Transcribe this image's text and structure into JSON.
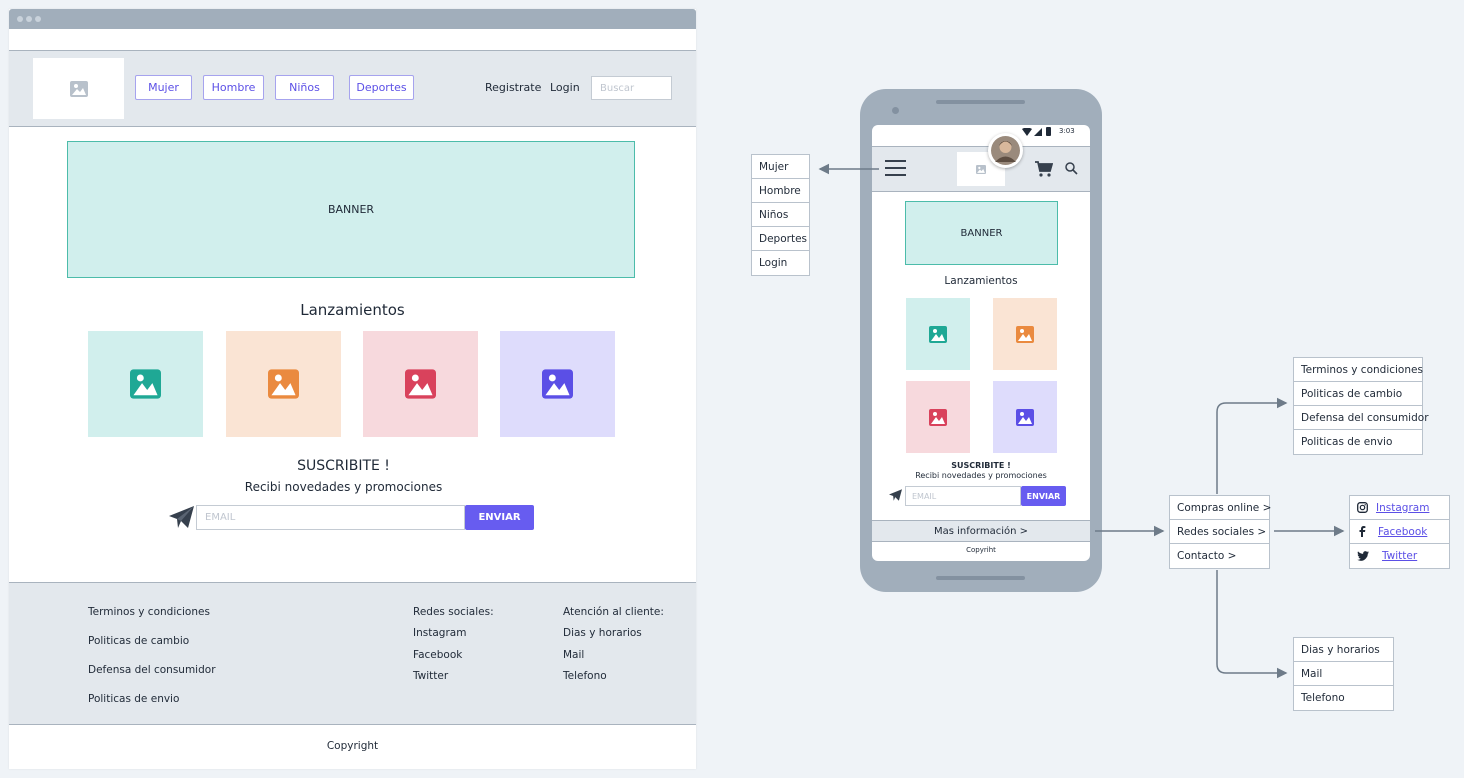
{
  "desktop": {
    "nav": [
      "Mujer",
      "Hombre",
      "Niños",
      "Deportes"
    ],
    "register": "Registrate",
    "login": "Login",
    "search_placeholder": "Buscar",
    "banner": "BANNER",
    "releases_title": "Lanzamientos",
    "subscribe_title": "SUSCRIBITE !",
    "subscribe_sub": "Recibi novedades y promociones",
    "email_placeholder": "EMAIL",
    "send_label": "ENVIAR",
    "footer": {
      "legal": [
        "Terminos y condiciones",
        "Politicas de cambio",
        "Defensa del consumidor",
        "Politicas de envio"
      ],
      "social_title": "Redes sociales:",
      "social": [
        "Instagram",
        "Facebook",
        "Twitter"
      ],
      "support_title": "Atención al cliente:",
      "support": [
        "Dias y horarios",
        "Mail",
        "Telefono"
      ]
    },
    "copyright": "Copyright"
  },
  "mobile": {
    "time": "3:03",
    "banner": "BANNER",
    "releases_title": "Lanzamientos",
    "subscribe_title": "SUSCRIBITE !",
    "subscribe_sub": "Recibi novedades y promociones",
    "email_placeholder": "EMAIL",
    "send_label": "ENVIAR",
    "more_info": "Mas información  >",
    "copyright": "Copyriht"
  },
  "menus": {
    "hamburger": [
      "Mujer",
      "Hombre",
      "Niños",
      "Deportes",
      "Login"
    ],
    "more_info": [
      "Compras online  >",
      "Redes sociales  >",
      "Contacto  >"
    ],
    "legal": [
      "Terminos y condiciones",
      "Politicas de cambio",
      "Defensa del consumidor",
      "Politicas de envio"
    ],
    "social": [
      "Instagram",
      "Facebook",
      "Twitter"
    ],
    "contact": [
      "Dias y horarios",
      "Mail",
      "Telefono"
    ]
  },
  "colors": {
    "teal": "#1fa895",
    "orange": "#ea8a3f",
    "red": "#d9425c",
    "purple": "#5b4fe6",
    "accent": "#675cf0"
  }
}
